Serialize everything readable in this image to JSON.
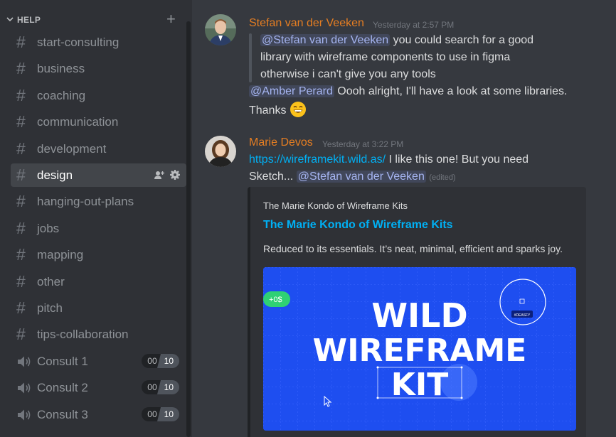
{
  "sidebar": {
    "category": "HELP",
    "plus_icon": "plus-icon",
    "channels": [
      {
        "name": "start-consulting"
      },
      {
        "name": "business"
      },
      {
        "name": "coaching"
      },
      {
        "name": "communication"
      },
      {
        "name": "development"
      },
      {
        "name": "design",
        "active": true
      },
      {
        "name": "hanging-out-plans"
      },
      {
        "name": "jobs"
      },
      {
        "name": "mapping"
      },
      {
        "name": "other"
      },
      {
        "name": "pitch"
      },
      {
        "name": "tips-collaboration"
      }
    ],
    "hash_glyph": "#",
    "voice_channels": [
      {
        "name": "Consult 1",
        "used": "00",
        "max": "10"
      },
      {
        "name": "Consult 2",
        "used": "00",
        "max": "10"
      },
      {
        "name": "Consult 3",
        "used": "00",
        "max": "10"
      }
    ]
  },
  "messages": [
    {
      "author": "Stefan van der Veeken",
      "time": "Yesterday at 2:57 PM",
      "quote": {
        "mention": "@Stefan van der Veeken",
        "line1_rest": " you could search for a good",
        "line2": "library with wireframe components to use in figma",
        "line3": "otherwise i can't give you any tools"
      },
      "reply_mention": "@Amber Perard",
      "reply_rest": " Oooh alright, I'll have a look at some libraries.",
      "reply_line2": "Thanks"
    },
    {
      "author": "Marie Devos",
      "time": "Yesterday at 3:22 PM",
      "link": "https://wireframekit.wild.as/",
      "line1_rest": " I like this one! But you need",
      "line2_text": "Sketch...",
      "line2_mention": "@Stefan van der Veeken",
      "edited": "(edited)",
      "embed": {
        "provider": "The Marie Kondo of Wireframe Kits",
        "title": "The Marie Kondo of Wireframe Kits",
        "description": "Reduced to its essentials. It’s neat, minimal, efficient and sparks joy.",
        "image": {
          "headline_1": "WILD",
          "headline_2": "WIREFRAME",
          "headline_3": "KIT",
          "badge": "+0$",
          "circle_tag": "#DEASFY"
        }
      }
    }
  ],
  "colors": {
    "author": "#e67e22",
    "link": "#00b0f4",
    "embed_image_bg": "#1e4ef0"
  }
}
